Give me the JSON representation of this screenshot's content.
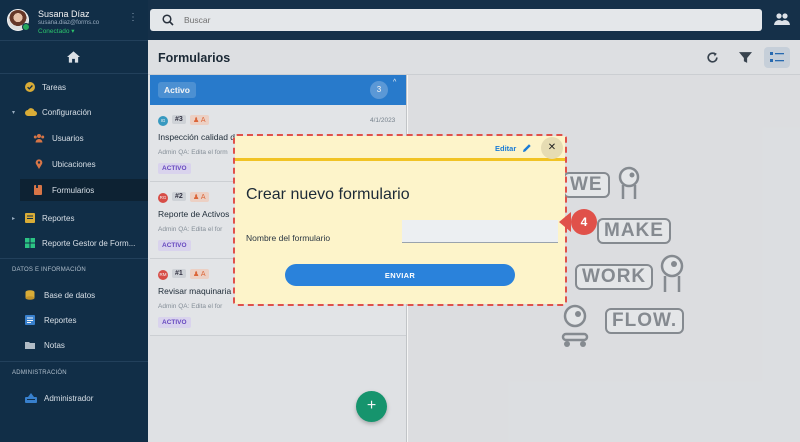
{
  "user": {
    "name": "Susana Díaz",
    "email": "susana.diaz@forms.co",
    "status": "Conectado"
  },
  "sidebar": {
    "items": [
      {
        "label": "Tareas",
        "icon": "check-circle-icon"
      },
      {
        "label": "Configuración",
        "icon": "cloud-icon"
      },
      {
        "label": "Usuarios",
        "icon": "users-icon"
      },
      {
        "label": "Ubicaciones",
        "icon": "location-pin-icon"
      },
      {
        "label": "Formularios",
        "icon": "form-icon"
      },
      {
        "label": "Reportes",
        "icon": "report-icon"
      },
      {
        "label": "Reporte Gestor de Form...",
        "icon": "grid-icon"
      }
    ],
    "section_data": "DATOS E INFORMACIÓN",
    "data_items": [
      {
        "label": "Base de datos",
        "icon": "database-icon"
      },
      {
        "label": "Reportes",
        "icon": "list-icon"
      },
      {
        "label": "Notas",
        "icon": "folder-icon"
      }
    ],
    "section_admin": "ADMINISTRACIÓN",
    "admin_items": [
      {
        "label": "Administrador",
        "icon": "admin-icon"
      }
    ]
  },
  "search": {
    "placeholder": "Buscar"
  },
  "header": {
    "title": "Formularios"
  },
  "list": {
    "header_label": "Activo",
    "count": "3",
    "cards": [
      {
        "avatar": "IG",
        "avatar_color": "#3aa0c8",
        "number": "#3",
        "flag": "A",
        "date": "4/1/2023",
        "title": "Inspección calidad d",
        "sub": "Admin QA: Edita el form",
        "status": "ACTIVO"
      },
      {
        "avatar": "RG",
        "avatar_color": "#e0514a",
        "number": "#2",
        "flag": "A",
        "date": "",
        "title": "Reporte de Activos",
        "sub": "Admin QA: Edita el for",
        "status": "ACTIVO"
      },
      {
        "avatar": "RM",
        "avatar_color": "#e0514a",
        "number": "#1",
        "flag": "A",
        "date": "",
        "title": "Revisar maquinaria",
        "sub": "Admin QA: Edita el for",
        "status": "ACTIVO"
      }
    ],
    "fab_label": "+"
  },
  "illustration": {
    "words": [
      "WE",
      "MAKE",
      "WORK",
      "FLOW."
    ]
  },
  "modal": {
    "edit_label": "Editar",
    "close_label": "✕",
    "title": "Crear nuevo formulario",
    "field_label": "Nombre del formulario",
    "field_value": "",
    "submit_label": "ENVIAR"
  },
  "step": {
    "number": "4",
    "color": "#e0514a"
  },
  "colors": {
    "sidebar": "#12304a",
    "accent": "#2a7fd4",
    "modal_bg": "#fdf4ca",
    "modal_rule": "#f1c325",
    "fab": "#179b72"
  }
}
